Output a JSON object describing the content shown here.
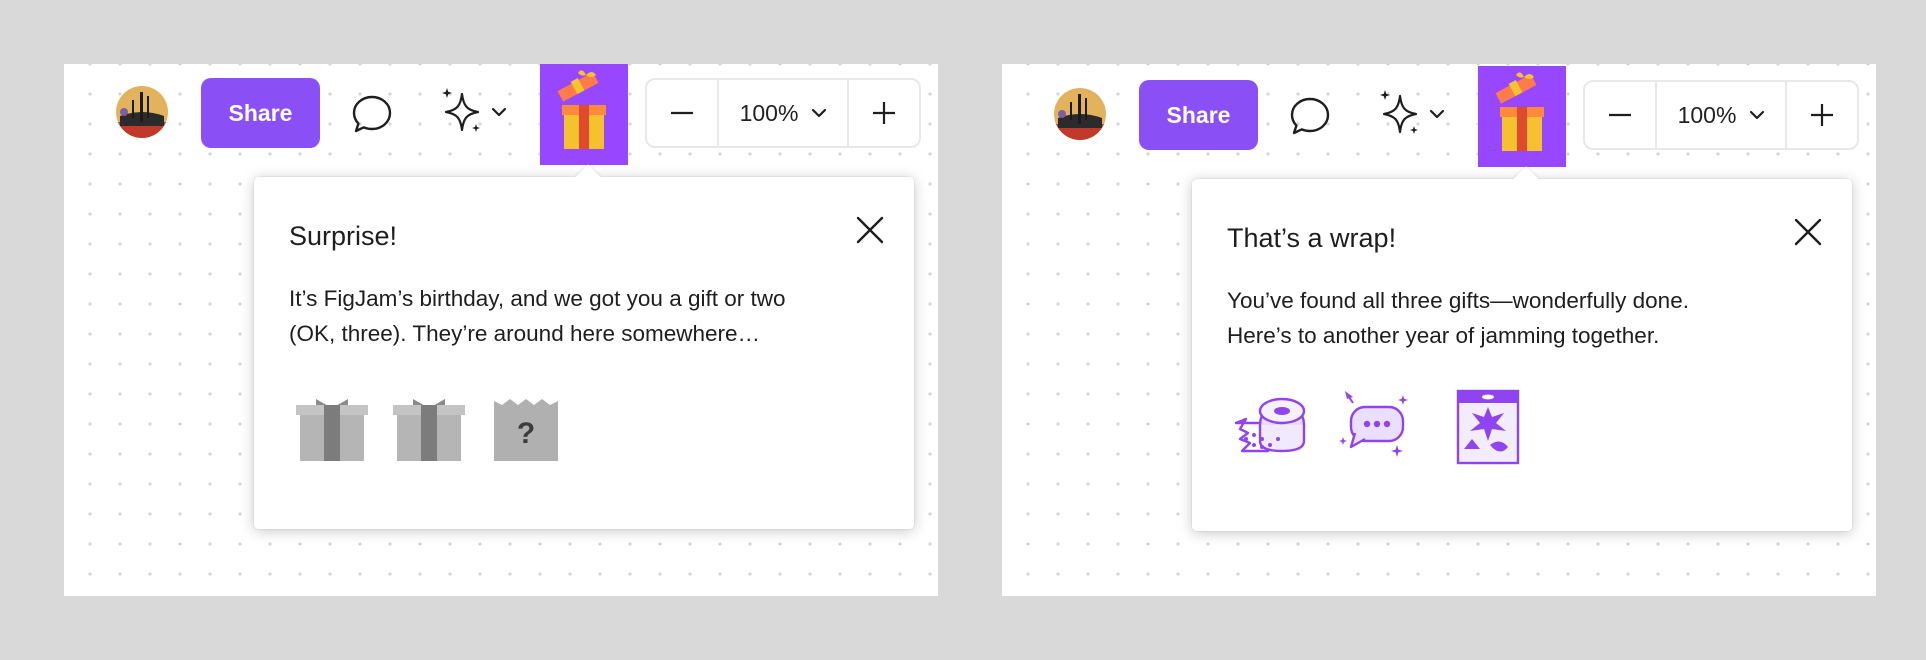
{
  "panels": [
    {
      "toolbar": {
        "share_label": "Share",
        "zoom_level": "100%",
        "gift_button_color": "#9747ff"
      },
      "popover": {
        "title": "Surprise!",
        "body_lines": [
          "It’s FigJam’s birthday, and we got you a gift or two",
          "(OK, three). They’re around here somewhere…"
        ],
        "gifts": [
          "gift-box-icon",
          "gift-box-icon",
          "mystery-gift-icon"
        ]
      }
    },
    {
      "toolbar": {
        "share_label": "Share",
        "zoom_level": "100%",
        "gift_button_color": "#9747ff"
      },
      "popover": {
        "title": "That’s a wrap!",
        "body_lines": [
          "You’ve found all three gifts—wonderfully done.",
          "Here’s to another year of jamming together."
        ],
        "gifts": [
          "washi-tape-icon",
          "chat-bubble-sparkle-icon",
          "sticker-pack-icon"
        ]
      }
    }
  ],
  "colors": {
    "accent": "#8a4ff5",
    "gift_gray_light": "#b7b7b7",
    "gift_gray_dark": "#7a7a7a",
    "purple_icon": "#8f44f0"
  }
}
